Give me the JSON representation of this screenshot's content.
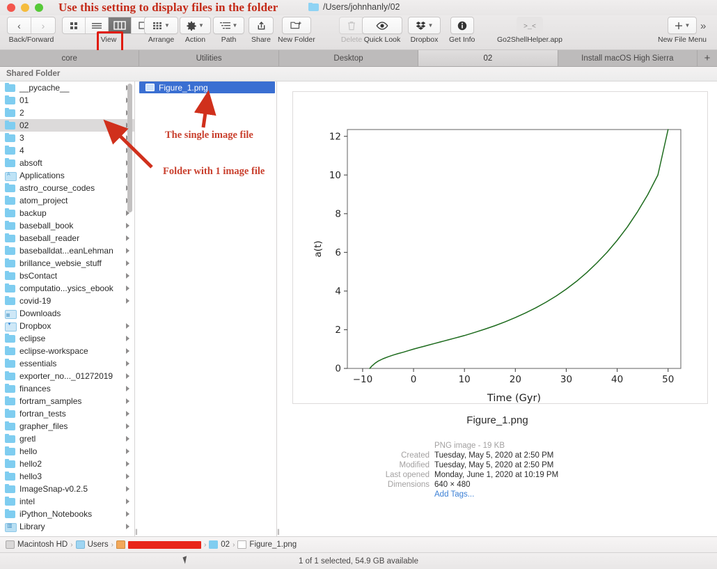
{
  "window": {
    "title": "/Users/johnhanly/02",
    "title_icon": "folder-icon",
    "traffic_lights": [
      "close-button",
      "minimize-button",
      "zoom-button"
    ]
  },
  "annotations": {
    "top": "Use this setting to display files in the folder",
    "single_file": "The single image file",
    "folder_note": "Folder with 1 image file"
  },
  "toolbar": {
    "back_forward_label": "Back/Forward",
    "back_icon": "chevron-left-icon",
    "forward_icon": "chevron-right-icon",
    "view_label": "View",
    "view_segments": [
      "icon-view-icon",
      "list-view-icon",
      "column-view-icon",
      "gallery-view-icon"
    ],
    "view_selected_index": 2,
    "arrange_label": "Arrange",
    "arrange_icon": "grid-icon",
    "action_label": "Action",
    "action_icon": "gear-icon",
    "path_label": "Path",
    "path_icon": "path-list-icon",
    "share_label": "Share",
    "share_icon": "share-up-arrow-icon",
    "new_folder_label": "New Folder",
    "new_folder_icon": "new-folder-icon",
    "delete_label": "Delete",
    "delete_icon": "trash-icon",
    "quick_look_label": "Quick Look",
    "quick_look_icon": "eye-icon",
    "dropbox_label": "Dropbox",
    "dropbox_icon": "dropbox-icon",
    "get_info_label": "Get Info",
    "get_info_icon": "info-circle-icon",
    "go2shell_label": "Go2ShellHelper.app",
    "go2shell_icon": "terminal-prompt-icon",
    "new_file_menu_label": "New File Menu",
    "new_file_menu_icon": "plus-icon",
    "overflow_icon": "chevron-double-right-icon"
  },
  "tabs": {
    "items": [
      "core",
      "Utilities",
      "Desktop",
      "02",
      "Install macOS High Sierra"
    ],
    "active_index": 3,
    "add_tab_label": "+"
  },
  "shared_bar": {
    "label": "Shared Folder"
  },
  "sidebar": {
    "selected": "02",
    "items": [
      {
        "name": "__pycache__",
        "icon": "folder",
        "disclosure": true
      },
      {
        "name": "01",
        "icon": "folder",
        "disclosure": true
      },
      {
        "name": "2",
        "icon": "folder",
        "disclosure": true
      },
      {
        "name": "02",
        "icon": "folder",
        "disclosure": true
      },
      {
        "name": "3",
        "icon": "folder",
        "disclosure": true
      },
      {
        "name": "4",
        "icon": "folder",
        "disclosure": true
      },
      {
        "name": "absoft",
        "icon": "folder",
        "disclosure": true
      },
      {
        "name": "Applications",
        "icon": "apps",
        "disclosure": true
      },
      {
        "name": "astro_course_codes",
        "icon": "folder",
        "disclosure": true
      },
      {
        "name": "atom_project",
        "icon": "folder",
        "disclosure": true
      },
      {
        "name": "backup",
        "icon": "folder",
        "disclosure": true
      },
      {
        "name": "baseball_book",
        "icon": "folder",
        "disclosure": true
      },
      {
        "name": "baseball_reader",
        "icon": "folder",
        "disclosure": true
      },
      {
        "name": "baseballdat...eanLehman",
        "icon": "folder",
        "disclosure": true
      },
      {
        "name": "brillance_websie_stuff",
        "icon": "folder",
        "disclosure": true
      },
      {
        "name": "bsContact",
        "icon": "folder",
        "disclosure": true
      },
      {
        "name": "computatio...ysics_ebook",
        "icon": "folder",
        "disclosure": true
      },
      {
        "name": "covid-19",
        "icon": "folder",
        "disclosure": true
      },
      {
        "name": "Downloads",
        "icon": "down",
        "disclosure": false
      },
      {
        "name": "Dropbox",
        "icon": "drop",
        "disclosure": true
      },
      {
        "name": "eclipse",
        "icon": "folder",
        "disclosure": true
      },
      {
        "name": "eclipse-workspace",
        "icon": "folder",
        "disclosure": true
      },
      {
        "name": "essentials",
        "icon": "folder",
        "disclosure": true
      },
      {
        "name": "exporter_no..._01272019",
        "icon": "folder",
        "disclosure": true
      },
      {
        "name": "finances",
        "icon": "folder",
        "disclosure": true
      },
      {
        "name": "fortram_samples",
        "icon": "folder",
        "disclosure": true
      },
      {
        "name": "fortran_tests",
        "icon": "folder",
        "disclosure": true
      },
      {
        "name": "grapher_files",
        "icon": "folder",
        "disclosure": true
      },
      {
        "name": "gretl",
        "icon": "folder",
        "disclosure": true
      },
      {
        "name": "hello",
        "icon": "folder",
        "disclosure": true
      },
      {
        "name": "hello2",
        "icon": "folder",
        "disclosure": true
      },
      {
        "name": "hello3",
        "icon": "folder",
        "disclosure": true
      },
      {
        "name": "ImageSnap-v0.2.5",
        "icon": "folder",
        "disclosure": true
      },
      {
        "name": "intel",
        "icon": "folder",
        "disclosure": true
      },
      {
        "name": "iPython_Notebooks",
        "icon": "folder",
        "disclosure": true
      },
      {
        "name": "Library",
        "icon": "lib",
        "disclosure": true
      }
    ]
  },
  "filelist": {
    "items": [
      {
        "name": "Figure_1.png",
        "icon": "png-preview-icon",
        "selected": true
      }
    ]
  },
  "preview": {
    "filename": "Figure_1.png",
    "kind_label": "",
    "kind": "PNG image - 19 KB",
    "created_label": "Created",
    "created": "Tuesday, May 5, 2020 at 2:50 PM",
    "modified_label": "Modified",
    "modified": "Tuesday, May 5, 2020 at 2:50 PM",
    "last_opened_label": "Last opened",
    "last_opened": "Monday, June 1, 2020 at 10:19 PM",
    "dimensions_label": "Dimensions",
    "dimensions": "640 × 480",
    "add_tags": "Add Tags..."
  },
  "chart_data": {
    "type": "line",
    "title": "",
    "xlabel": "Time (Gyr)",
    "ylabel": "a(t)",
    "xlim": [
      -13.0,
      52.5
    ],
    "ylim": [
      0,
      12.35
    ],
    "xticks": [
      -10,
      0,
      10,
      20,
      30,
      40,
      50
    ],
    "xticklabels": [
      "−10",
      "0",
      "10",
      "20",
      "30",
      "40",
      "50"
    ],
    "yticks": [
      0,
      2,
      4,
      6,
      8,
      10,
      12
    ],
    "yticklabels": [
      "0",
      "2",
      "4",
      "6",
      "8",
      "10",
      "12"
    ],
    "grid": false,
    "legend": null,
    "line_color": "#1d6b1d",
    "line_width": 1.5,
    "series": [
      {
        "name": "a(t)",
        "x": [
          -8.6,
          -8.2,
          -7.6,
          -7.0,
          -6.0,
          -5.0,
          -4.0,
          -3.0,
          -2.0,
          -1.0,
          0.0,
          1.0,
          2.0,
          3.0,
          4.0,
          5.0,
          6.0,
          7.0,
          8.0,
          9.0,
          10.0,
          12.0,
          14.0,
          16.0,
          18.0,
          20.0,
          22.0,
          24.0,
          26.0,
          28.0,
          30.0,
          32.0,
          34.0,
          36.0,
          38.0,
          40.0,
          42.0,
          44.0,
          46.0,
          48.0,
          50.0
        ],
        "y": [
          0.0,
          0.12,
          0.26,
          0.37,
          0.5,
          0.6,
          0.69,
          0.77,
          0.84,
          0.92,
          1.0,
          1.07,
          1.14,
          1.21,
          1.28,
          1.35,
          1.42,
          1.49,
          1.56,
          1.63,
          1.7,
          1.86,
          2.03,
          2.21,
          2.41,
          2.63,
          2.87,
          3.13,
          3.42,
          3.74,
          4.1,
          4.5,
          4.95,
          5.45,
          6.0,
          6.62,
          7.31,
          8.1,
          8.98,
          10.0,
          12.35
        ]
      }
    ]
  },
  "breadcrumb": {
    "items": [
      {
        "label": "Macintosh HD",
        "icon": "hd"
      },
      {
        "label": "Users",
        "icon": "usr"
      },
      {
        "label": "",
        "icon": "home",
        "redacted": true
      },
      {
        "label": "02",
        "icon": "fld"
      },
      {
        "label": "Figure_1.png",
        "icon": "doc"
      }
    ]
  },
  "status": {
    "text": "1 of 1 selected, 54.9 GB available"
  }
}
